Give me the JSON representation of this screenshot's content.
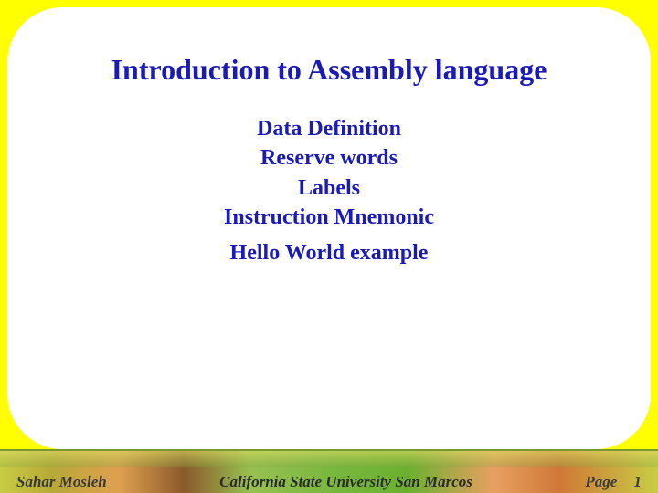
{
  "slide": {
    "title": "Introduction to Assembly language",
    "topics": [
      "Data Definition",
      "Reserve words",
      "Labels",
      "Instruction Mnemonic",
      "Hello World example"
    ]
  },
  "footer": {
    "author": "Sahar Mosleh",
    "institution": "California State University San Marcos",
    "page_label": "Page",
    "page_number": "1"
  }
}
